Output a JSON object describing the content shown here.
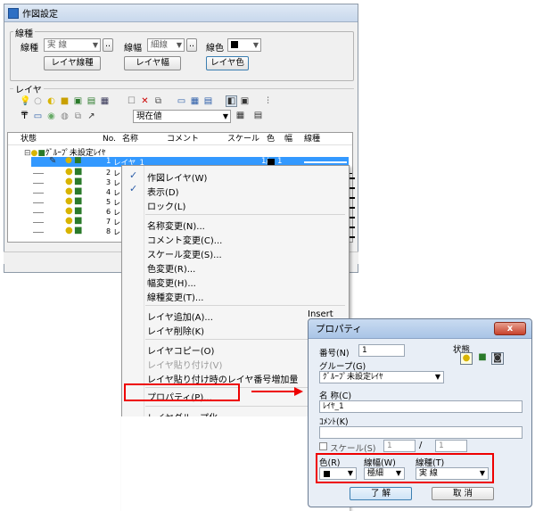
{
  "window": {
    "title": "作図設定"
  },
  "linetype_group": {
    "label": "線種",
    "linetype_label": "線種",
    "linetype_value": "実 線",
    "linewidth_label": "線幅",
    "linewidth_value": "細線",
    "linecolor_label": "線色",
    "btn_layer_linetype": "レイヤ線種",
    "btn_layer_width": "レイヤ幅",
    "btn_layer_color": "レイヤ色"
  },
  "layer_group": {
    "label": "レイヤ",
    "combo_value": "現在値"
  },
  "list": {
    "headers": [
      "状態",
      "No.",
      "名称",
      "コメント",
      "スケール",
      "色",
      "幅",
      "線種"
    ],
    "group_name": "ｸﾞﾙｰﾌﾟ未設定ﾚｲﾔ",
    "rows": [
      {
        "no": "1",
        "name": "レイヤ_1",
        "scale": "1/",
        "scale2": "1"
      },
      {
        "no": "2",
        "name": "レ"
      },
      {
        "no": "3",
        "name": "レ"
      },
      {
        "no": "4",
        "name": "レ"
      },
      {
        "no": "5",
        "name": "レ"
      },
      {
        "no": "6",
        "name": "レ"
      },
      {
        "no": "7",
        "name": "レ"
      },
      {
        "no": "8",
        "name": "レ"
      }
    ]
  },
  "context_menu": {
    "items": [
      {
        "label": "作図レイヤ(W)",
        "checked": true
      },
      {
        "label": "表示(D)",
        "checked": true
      },
      {
        "label": "ロック(L)"
      },
      {
        "label": "名称変更(N)..."
      },
      {
        "label": "コメント変更(C)..."
      },
      {
        "label": "スケール変更(S)..."
      },
      {
        "label": "色変更(R)..."
      },
      {
        "label": "幅変更(H)..."
      },
      {
        "label": "線種変更(T)..."
      },
      {
        "label": "レイヤ追加(A)...",
        "shortcut": "Insert"
      },
      {
        "label": "レイヤ削除(K)",
        "shortcut": "De"
      },
      {
        "label": "レイヤコピー(O)",
        "shortcut": "Ct"
      },
      {
        "label": "レイヤ貼り付け(V)",
        "shortcut": "Ct",
        "disabled": true
      },
      {
        "label": "レイヤ貼り付け時のレイヤ番号増加量"
      },
      {
        "label": "プロパティ(P)..."
      },
      {
        "label": "レイヤグループ化"
      }
    ]
  },
  "dialog": {
    "title": "プロパティ",
    "close": "x",
    "number_label": "番号(N)",
    "number_value": "1",
    "status_label": "状態",
    "group_label": "グループ(G)",
    "group_value": "ｸﾞﾙｰﾌﾟ未設定ﾚｲﾔ",
    "name_label": "名 称(C)",
    "name_value": "ﾚｲﾔ_1",
    "comment_label": "ｺﾒﾝﾄ(K)",
    "comment_value": "",
    "scale_label": "スケール(S)",
    "scale_num": "1",
    "scale_sep": "/",
    "scale_den": "1",
    "color_label": "色(R)",
    "width_label": "線幅(W)",
    "width_value": "極細",
    "linetype_label": "線種(T)",
    "linetype_value": "実 線",
    "ok": "了 解",
    "cancel": "取 消"
  },
  "colors": {
    "highlight_red": "#ee0000",
    "accent_blue": "#3399ff"
  }
}
